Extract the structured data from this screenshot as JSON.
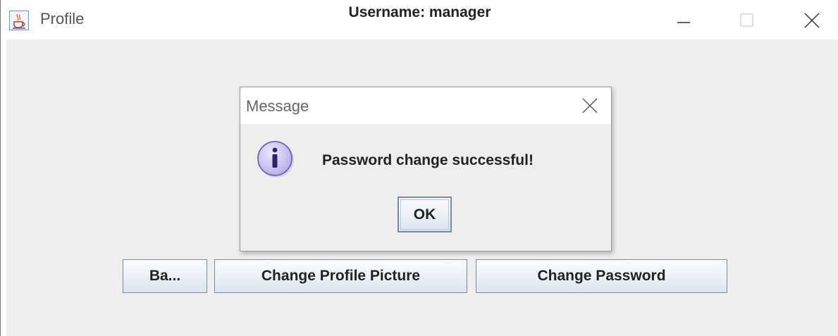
{
  "window": {
    "title": "Profile",
    "icon": "java-coffee-icon",
    "controls": [
      "minimize-icon",
      "maximize-icon",
      "close-icon"
    ]
  },
  "profile": {
    "username_label": "Username: manager",
    "buttons": {
      "back": "Ba...",
      "change_picture": "Change Profile Picture",
      "change_password": "Change Password"
    }
  },
  "dialog": {
    "title": "Message",
    "icon": "info-icon",
    "message": "Password change successful!",
    "ok_label": "OK"
  },
  "colors": {
    "panel_background": "#eeeeee",
    "button_border": "#7a8aa3",
    "info_icon_fill": "#c9c2ef"
  }
}
